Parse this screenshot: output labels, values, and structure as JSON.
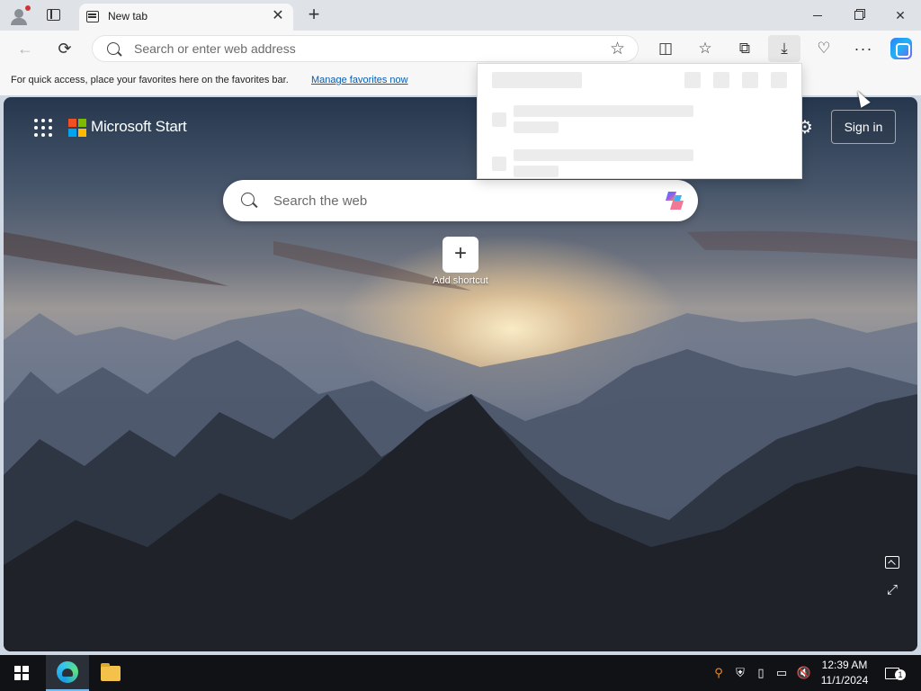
{
  "tab": {
    "title": "New tab",
    "close": "✕"
  },
  "new_tab": "+",
  "window": {
    "minimize": "minimize",
    "maximize": "maximize",
    "close": "✕"
  },
  "address": {
    "placeholder": "Search or enter web address"
  },
  "favorites_bar": {
    "text": "For quick access, place your favorites here on the favorites bar.",
    "link": "Manage favorites now"
  },
  "start_page": {
    "brand": "Microsoft Start",
    "sign_in": "Sign in",
    "search_placeholder": "Search the web",
    "shortcut_label": "Add shortcut",
    "shortcut_glyph": "+"
  },
  "icons": {
    "back": "←",
    "refresh": "⟳",
    "star": "☆",
    "split": "◫",
    "favorites": "☆",
    "collections": "⧉",
    "download": "⤓",
    "essentials": "♡",
    "more": "···",
    "gear": "⚙",
    "expand": "⤢",
    "tray_search": "⚲",
    "tray_shield": "⛨",
    "tray_usb": "▯",
    "tray_net": "▭",
    "tray_vol": "🔇"
  },
  "taskbar": {
    "time": "12:39 AM",
    "date": "11/1/2024",
    "notification_count": "1"
  },
  "colors": {
    "accent": "#0b5cad",
    "taskbar": "#101216",
    "edge_highlight": "#76b9ed"
  }
}
